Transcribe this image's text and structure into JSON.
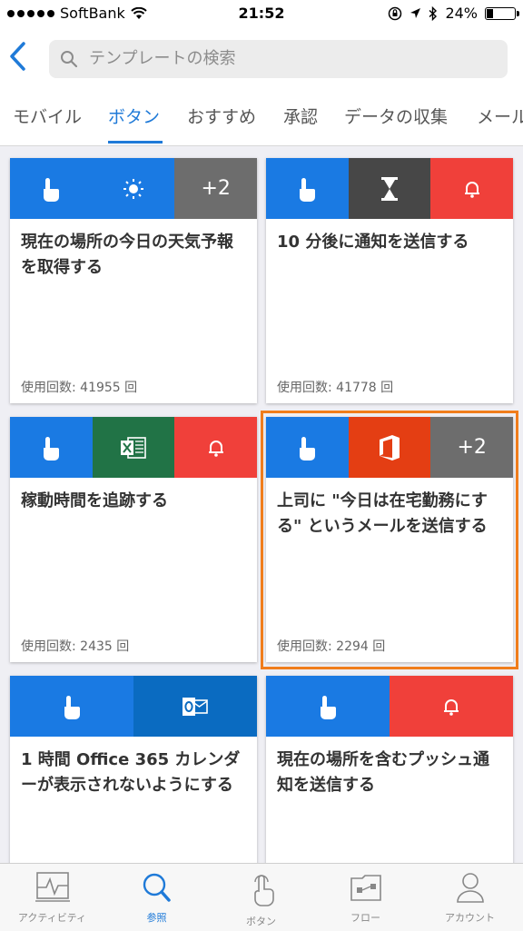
{
  "status_bar": {
    "carrier": "SoftBank",
    "time": "21:52",
    "battery": "24%",
    "battery_level": 0.24
  },
  "search": {
    "placeholder": "テンプレートの検索"
  },
  "tabs": [
    {
      "label": "モバイル"
    },
    {
      "label": "ボタン"
    },
    {
      "label": "おすすめ"
    },
    {
      "label": "承認"
    },
    {
      "label": "データの収集"
    },
    {
      "label": "メール"
    }
  ],
  "cards": [
    {
      "title": "現在の場所の今日の天気予報を取得する",
      "usage": "使用回数: 41955 回",
      "icons": [
        "button-icon",
        "sun-icon",
        "+2"
      ]
    },
    {
      "title": "10 分後に通知を送信する",
      "usage": "使用回数: 41778 回",
      "icons": [
        "button-icon",
        "hourglass-icon",
        "bell-icon"
      ]
    },
    {
      "title": "稼動時間を追跡する",
      "usage": "使用回数: 2435 回",
      "icons": [
        "button-icon",
        "excel-icon",
        "bell-icon"
      ]
    },
    {
      "title": "上司に \"今日は在宅勤務にする\" というメールを送信する",
      "usage": "使用回数: 2294 回",
      "icons": [
        "button-icon",
        "office-icon",
        "+2"
      ]
    },
    {
      "title": "1 時間 Office 365 カレンダーが表示されないようにする",
      "usage": "",
      "icons": [
        "button-icon",
        "outlook-icon"
      ]
    },
    {
      "title": "現在の場所を含むプッシュ通知を送信する",
      "usage": "",
      "icons": [
        "button-icon",
        "bell-icon"
      ]
    }
  ],
  "colors": {
    "accent": "#1f7ad8",
    "button_blue": "#1a7ae3",
    "gray": "#6d6d6d",
    "red": "#f0403a",
    "excel_green": "#217346",
    "office_orange": "#e43e13",
    "outlook_blue": "#0a6bc1",
    "dark_gray": "#474747",
    "selection": "#f07d1c"
  },
  "bottom_nav": [
    {
      "label": "アクティビティ",
      "icon": "activity-icon"
    },
    {
      "label": "参照",
      "icon": "search-icon"
    },
    {
      "label": "ボタン",
      "icon": "touch-icon"
    },
    {
      "label": "フロー",
      "icon": "flow-icon"
    },
    {
      "label": "アカウント",
      "icon": "account-icon"
    }
  ]
}
